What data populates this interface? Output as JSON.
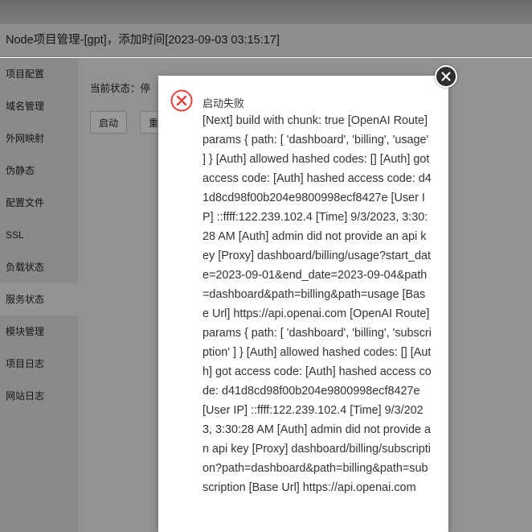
{
  "window": {
    "title": "Node项目管理-[gpt]，添加时间[2023-09-03 03:15:17]"
  },
  "sidebar": {
    "items": [
      {
        "label": "项目配置"
      },
      {
        "label": "域名管理"
      },
      {
        "label": "外网映射"
      },
      {
        "label": "伪静态"
      },
      {
        "label": "配置文件"
      },
      {
        "label": "SSL"
      },
      {
        "label": "负载状态"
      },
      {
        "label": "服务状态",
        "active": true
      },
      {
        "label": "模块管理"
      },
      {
        "label": "项目日志"
      },
      {
        "label": "网站日志"
      }
    ]
  },
  "main": {
    "status_label": "当前状态：停",
    "start_button": "启动",
    "restart_button": "重"
  },
  "dialog": {
    "icon": "error-circle-x-icon",
    "title": "启动失败",
    "message": "[Next] build with chunk: true [OpenAI Route] params { path: [ 'dashboard', 'billing', 'usage' ] } [Auth] allowed hashed codes: [] [Auth] got access code: [Auth] hashed access code: d41d8cd98f00b204e9800998ecf8427e [User IP] ::ffff:122.239.102.4 [Time] 9/3/2023, 3:30:28 AM [Auth] admin did not provide an api key [Proxy] dashboard/billing/usage?start_date=2023-09-01&end_date=2023-09-04&path=dashboard&path=billing&path=usage [Base Url] https://api.openai.com [OpenAI Route] params { path: [ 'dashboard', 'billing', 'subscription' ] } [Auth] allowed hashed codes: [] [Auth] got access code: [Auth] hashed access code: d41d8cd98f00b204e9800998ecf8427e [User IP] ::ffff:122.239.102.4 [Time] 9/3/2023, 3:30:28 AM [Auth] admin did not provide an api key [Proxy] dashboard/billing/subscription?path=dashboard&path=billing&path=subscription [Base Url] https://api.openai.com",
    "close_icon": "close-icon"
  },
  "colors": {
    "error_red": "#e8403c",
    "overlay_dim": "#929292"
  }
}
